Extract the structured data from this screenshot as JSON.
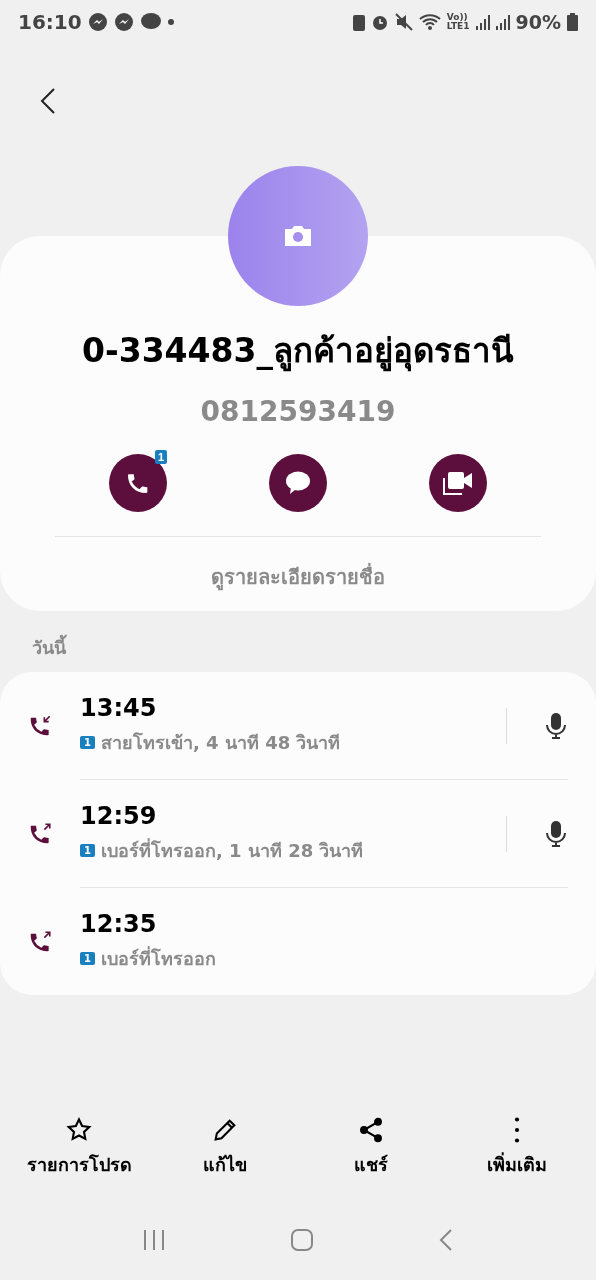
{
  "status_bar": {
    "time": "16:10",
    "volte": "Vo))",
    "network": "LTE1",
    "battery": "90%"
  },
  "contact": {
    "name": "0-334483_ลูกค้าอยู่อุดรธานี",
    "number": "0812593419",
    "call_badge": "1",
    "details_link": "ดูรายละเอียดรายชื่อ"
  },
  "section_title": "วันนี้",
  "calls": [
    {
      "kind": "incoming",
      "time": "13:45",
      "sim": "1",
      "detail": "สายโทรเข้า, 4 นาที 48 วินาที",
      "recorded": true
    },
    {
      "kind": "outgoing",
      "time": "12:59",
      "sim": "1",
      "detail": "เบอร์ที่โทรออก, 1 นาที 28 วินาที",
      "recorded": true
    },
    {
      "kind": "outgoing",
      "time": "12:35",
      "sim": "1",
      "detail": "เบอร์ที่โทรออก",
      "recorded": false
    }
  ],
  "toolbar": [
    {
      "kind": "favorite",
      "label": "รายการโปรด"
    },
    {
      "kind": "edit",
      "label": "แก้ไข"
    },
    {
      "kind": "share",
      "label": "แชร์"
    },
    {
      "kind": "more",
      "label": "เพิ่มเติม"
    }
  ]
}
